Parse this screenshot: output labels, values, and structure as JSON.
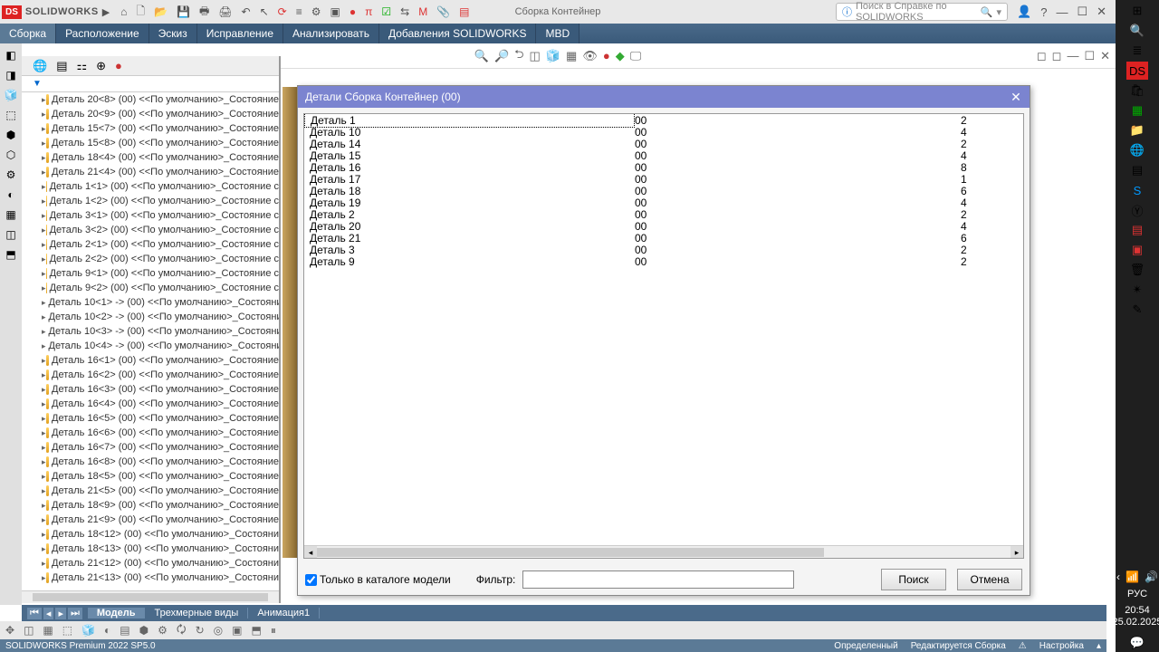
{
  "brand": "SOLIDWORKS",
  "doc_title": "Сборка Контейнер",
  "search_placeholder": "Поиск в Справке по SOLIDWORKS",
  "menubar": [
    "Сборка",
    "Расположение",
    "Эскиз",
    "Исправление",
    "Анализировать",
    "Добавления SOLIDWORKS",
    "MBD"
  ],
  "tree_items": [
    "Деталь 20<8> (00) <<По умолчанию>_Состояние",
    "Деталь 20<9> (00) <<По умолчанию>_Состояние",
    "Деталь 15<7> (00) <<По умолчанию>_Состояние",
    "Деталь 15<8> (00) <<По умолчанию>_Состояние",
    "Деталь 18<4> (00) <<По умолчанию>_Состояние",
    "Деталь 21<4> (00) <<По умолчанию>_Состояние",
    "Деталь 1<1> (00) <<По умолчанию>_Состояние с",
    "Деталь 1<2> (00) <<По умолчанию>_Состояние с",
    "Деталь 3<1> (00) <<По умолчанию>_Состояние с",
    "Деталь 3<2> (00) <<По умолчанию>_Состояние с",
    "Деталь 2<1> (00) <<По умолчанию>_Состояние с",
    "Деталь 2<2> (00) <<По умолчанию>_Состояние с",
    "Деталь 9<1> (00) <<По умолчанию>_Состояние с",
    "Деталь 9<2> (00) <<По умолчанию>_Состояние с",
    "Деталь 10<1> -> (00) <<По умолчанию>_Состояни",
    "Деталь 10<2> -> (00) <<По умолчанию>_Состояни",
    "Деталь 10<3> -> (00) <<По умолчанию>_Состояни",
    "Деталь 10<4> -> (00) <<По умолчанию>_Состояни",
    "Деталь 16<1> (00) <<По умолчанию>_Состояние",
    "Деталь 16<2> (00) <<По умолчанию>_Состояние",
    "Деталь 16<3> (00) <<По умолчанию>_Состояние",
    "Деталь 16<4> (00) <<По умолчанию>_Состояние",
    "Деталь 16<5> (00) <<По умолчанию>_Состояние",
    "Деталь 16<6> (00) <<По умолчанию>_Состояние",
    "Деталь 16<7> (00) <<По умолчанию>_Состояние",
    "Деталь 16<8> (00) <<По умолчанию>_Состояние",
    "Деталь 18<5> (00) <<По умолчанию>_Состояние",
    "Деталь 21<5> (00) <<По умолчанию>_Состояние",
    "Деталь 18<9> (00) <<По умолчанию>_Состояние",
    "Деталь 21<9> (00) <<По умолчанию>_Состояние",
    "Деталь 18<12> (00) <<По умолчанию>_Состояни",
    "Деталь 18<13> (00) <<По умолчанию>_Состояни",
    "Деталь 21<12> (00) <<По умолчанию>_Состояни",
    "Деталь 21<13> (00) <<По умолчанию>_Состояни"
  ],
  "dialog": {
    "title": "Детали Сборка Контейнер (00)",
    "rows": [
      {
        "name": "Деталь 1",
        "cfg": "00",
        "qty": "2"
      },
      {
        "name": "Деталь 10",
        "cfg": "00",
        "qty": "4"
      },
      {
        "name": "Деталь 14",
        "cfg": "00",
        "qty": "2"
      },
      {
        "name": "Деталь 15",
        "cfg": "00",
        "qty": "4"
      },
      {
        "name": "Деталь 16",
        "cfg": "00",
        "qty": "8"
      },
      {
        "name": "Деталь 17",
        "cfg": "00",
        "qty": "1"
      },
      {
        "name": "Деталь 18",
        "cfg": "00",
        "qty": "6"
      },
      {
        "name": "Деталь 19",
        "cfg": "00",
        "qty": "4"
      },
      {
        "name": "Деталь 2",
        "cfg": "00",
        "qty": "2"
      },
      {
        "name": "Деталь 20",
        "cfg": "00",
        "qty": "4"
      },
      {
        "name": "Деталь 21",
        "cfg": "00",
        "qty": "6"
      },
      {
        "name": "Деталь 3",
        "cfg": "00",
        "qty": "2"
      },
      {
        "name": "Деталь 9",
        "cfg": "00",
        "qty": "2"
      }
    ],
    "checkbox_label": "Только в каталоге модели",
    "filter_label": "Фильтр:",
    "search_btn": "Поиск",
    "cancel_btn": "Отмена"
  },
  "bottom_tabs": [
    "Модель",
    "Трехмерные виды",
    "Анимация1"
  ],
  "status": {
    "left": "SOLIDWORKS Premium 2022 SP5.0",
    "mode": "Определенный",
    "edit": "Редактируется Сборка",
    "custom": "Настройка"
  },
  "clock": {
    "time": "20:54",
    "date": "25.02.2025",
    "lang": "РУС"
  }
}
